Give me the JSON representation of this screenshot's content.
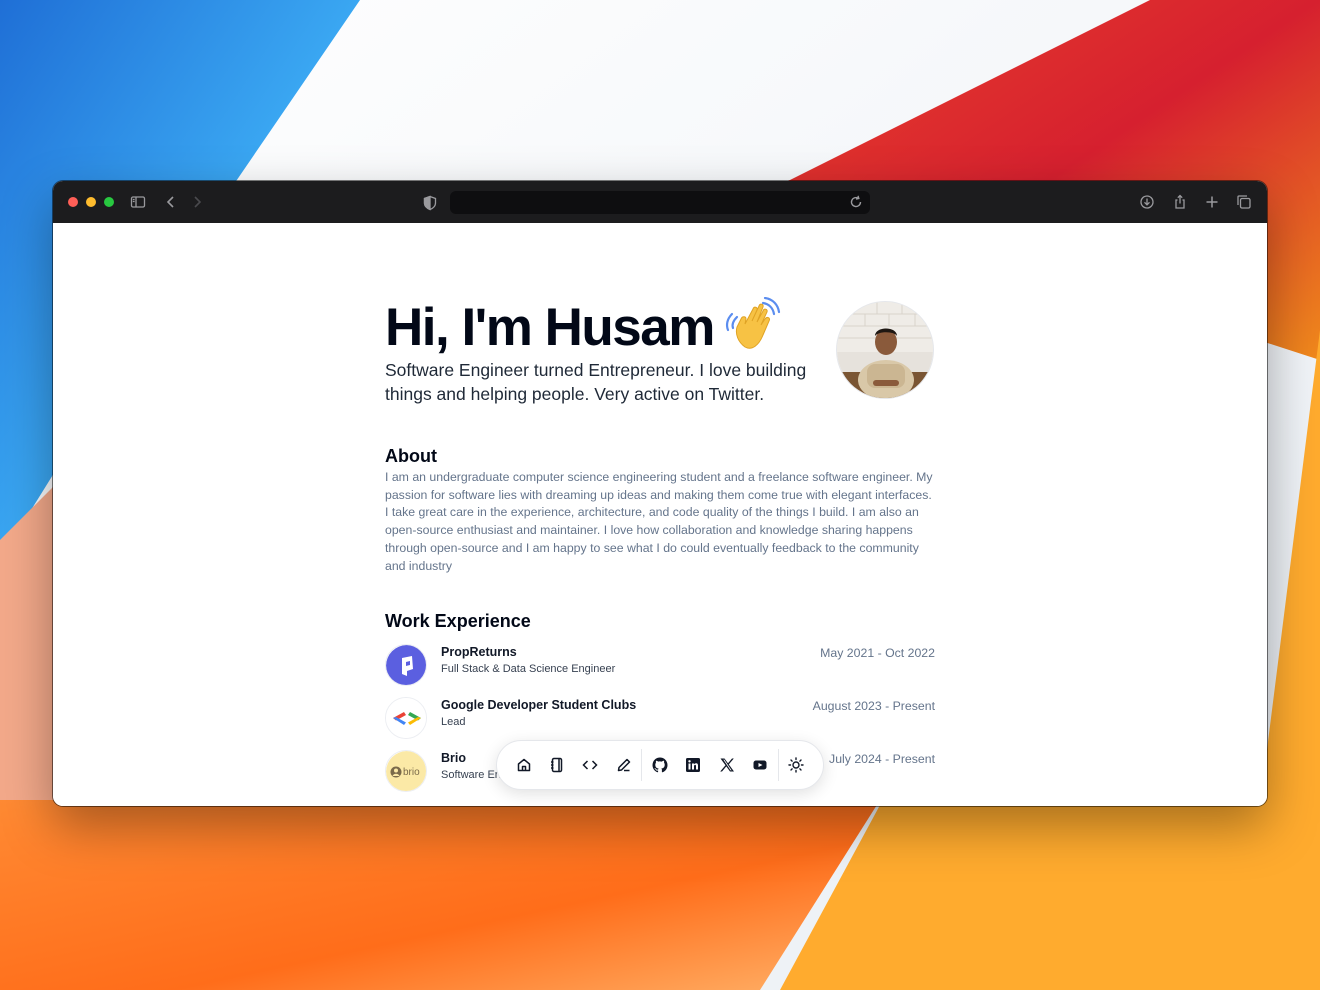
{
  "browser": {
    "address": ""
  },
  "hero": {
    "title": "Hi, I'm Husam",
    "subtitle": "Software Engineer turned Entrepreneur. I love building things and helping people. Very active on Twitter."
  },
  "about": {
    "heading": "About",
    "text": "I am an undergraduate computer science engineering student and a freelance software engineer. My passion for software lies with dreaming up ideas and making them come true with elegant interfaces. I take great care in the experience, architecture, and code quality of the things I build. I am also an open-source enthusiast and maintainer. I love how collaboration and knowledge sharing happens through open-source and I am happy to see what I do could eventually feedback to the community and industry"
  },
  "work": {
    "heading": "Work Experience",
    "items": [
      {
        "company": "PropReturns",
        "role": "Full Stack & Data Science Engineer",
        "dates": "May 2021 - Oct 2022"
      },
      {
        "company": "Google Developer Student Clubs",
        "role": "Lead",
        "dates": "August 2023 - Present"
      },
      {
        "company": "Brio",
        "role": "Software Engineer",
        "dates": "July 2024 - Present"
      }
    ]
  },
  "dock": {
    "items": [
      "home-icon",
      "notebook-icon",
      "code-icon",
      "pencil-icon",
      "github-icon",
      "linkedin-icon",
      "x-icon",
      "youtube-icon",
      "sun-icon"
    ]
  },
  "colors": {
    "accent_purple": "#5b5fe0",
    "titlebar": "#1c1c1e",
    "text_muted": "#64748b"
  }
}
